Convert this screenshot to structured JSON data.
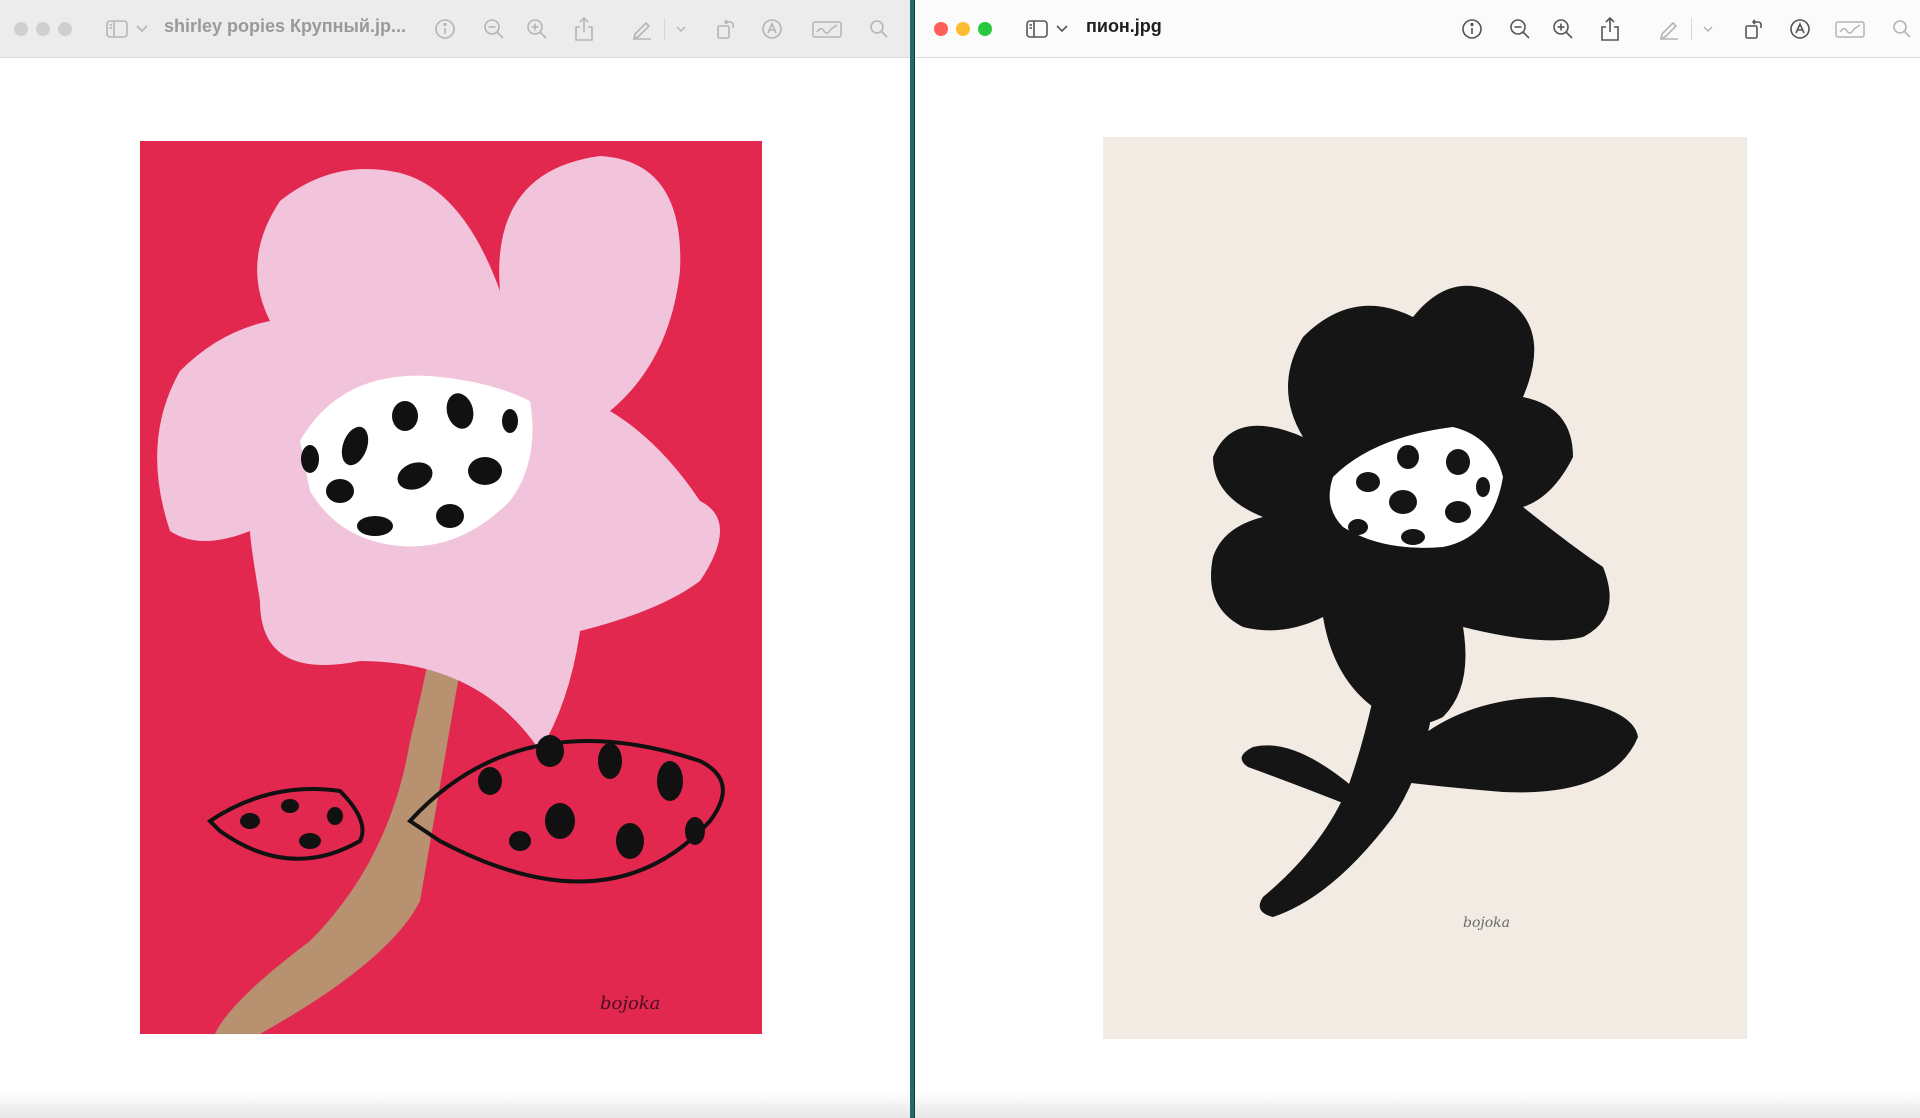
{
  "windows": [
    {
      "title": "shirley popies Крупный.jp...",
      "active": false,
      "artwork": {
        "paper_color": "#e2284f",
        "petal_color": "#f2c4dc",
        "stem_color": "#b89170",
        "ink_color": "#111111",
        "signature": "bojoka"
      }
    },
    {
      "title": "пион.jpg",
      "active": true,
      "artwork": {
        "paper_color": "#f1ebe3",
        "petal_color": "#151515",
        "center_color": "#ffffff",
        "ink_color": "#151515",
        "signature": "bojoka"
      }
    }
  ],
  "toolbar_icons": [
    "sidebar-icon",
    "chevron-down-icon",
    "info-icon",
    "zoom-out-icon",
    "zoom-in-icon",
    "share-icon",
    "markup-pen-icon",
    "chevron-down-icon",
    "rotate-icon",
    "annotate-icon",
    "signature-icon",
    "search-icon"
  ],
  "colors": {
    "desktop": "#1f6b66",
    "toolbar_icon_active": "#555555",
    "toolbar_icon_inactive": "#b5b5b5"
  }
}
